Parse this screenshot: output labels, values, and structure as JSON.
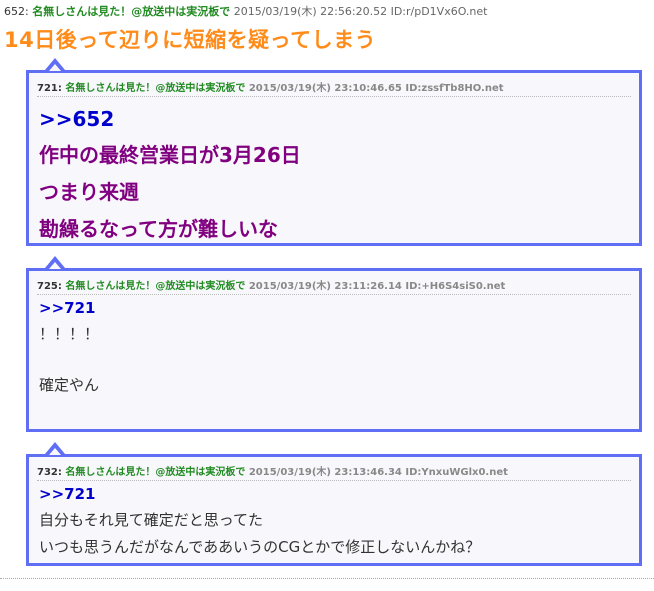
{
  "main_post": {
    "number": "652:",
    "name": "名無しさんは見た！@放送中は実況板で",
    "meta": "2015/03/19(木) 22:56:20.52 ID:r/pD1Vx6O.net",
    "title": "14日後って辺りに短縮を疑ってしまう"
  },
  "replies": [
    {
      "number": "721:",
      "name": "名無しさんは見た！@放送中は実況板で",
      "meta": "2015/03/19(木) 23:10:46.65 ID:zssfTb8HO.net",
      "anchor": ">>652",
      "lines": [
        "作中の最終営業日が3月26日",
        "つまり来週",
        "勘繰るなって方が難しいな"
      ]
    },
    {
      "number": "725:",
      "name": "名無しさんは見た！@放送中は実況板で",
      "meta": "2015/03/19(木) 23:11:26.14 ID:+H6S4siS0.net",
      "anchor": ">>721",
      "lines": [
        "！！！！",
        "",
        "確定やん"
      ]
    },
    {
      "number": "732:",
      "name": "名無しさんは見た！@放送中は実況板で",
      "meta": "2015/03/19(木) 23:13:46.34 ID:YnxuWGlx0.net",
      "anchor": ">>721",
      "lines": [
        "自分もそれ見て確定だと思ってた",
        "いつも思うんだがなんでああいうのCGとかで修正しないんかね？"
      ]
    }
  ]
}
